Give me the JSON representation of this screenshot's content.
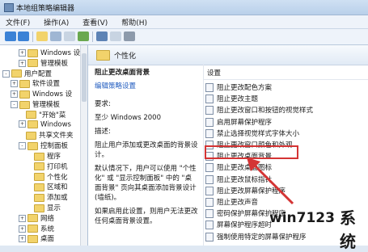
{
  "window": {
    "title": "本地组策略编辑器"
  },
  "menu": [
    "文件(F)",
    "操作(A)",
    "查看(V)",
    "帮助(H)"
  ],
  "tree": [
    {
      "label": "Windows 设",
      "depth": 2,
      "expander": "+"
    },
    {
      "label": "管理模板",
      "depth": 2,
      "expander": "+"
    },
    {
      "label": "用户配置",
      "depth": 0,
      "expander": "-"
    },
    {
      "label": "软件设置",
      "depth": 1,
      "expander": "+"
    },
    {
      "label": "Windows 设",
      "depth": 1,
      "expander": "+"
    },
    {
      "label": "管理模板",
      "depth": 1,
      "expander": "-"
    },
    {
      "label": "\"开始\"菜",
      "depth": 2,
      "expander": ""
    },
    {
      "label": "Windows",
      "depth": 2,
      "expander": "+"
    },
    {
      "label": "共享文件夹",
      "depth": 2,
      "expander": ""
    },
    {
      "label": "控制面板",
      "depth": 2,
      "expander": "-"
    },
    {
      "label": "程序",
      "depth": 3,
      "expander": ""
    },
    {
      "label": "打印机",
      "depth": 3,
      "expander": ""
    },
    {
      "label": "个性化",
      "depth": 3,
      "expander": ""
    },
    {
      "label": "区域和",
      "depth": 3,
      "expander": ""
    },
    {
      "label": "添加或",
      "depth": 3,
      "expander": ""
    },
    {
      "label": "显示",
      "depth": 3,
      "expander": ""
    },
    {
      "label": "网络",
      "depth": 2,
      "expander": "+"
    },
    {
      "label": "系统",
      "depth": 2,
      "expander": "+"
    },
    {
      "label": "桌面",
      "depth": 2,
      "expander": "+"
    }
  ],
  "main": {
    "header_title": "个性化",
    "policy_title": "阻止更改桌面背景",
    "edit_link": "编辑策略设置",
    "requirement_label": "要求:",
    "requirement_value": "至少 Windows 2000",
    "description_label": "描述:",
    "description_text": "阻止用户添加或更改桌面的背景设计。",
    "default_text": "默认情况下，用户可以使用 \"个性化\" 或 \"显示控制面板\" 中的 \"桌面背景\" 页向其桌面添加背景设计(墙纸)。",
    "enable_text": "如果启用此设置，则用户无法更改任何桌面背景设置。"
  },
  "settings": {
    "column_header": "设置",
    "items": [
      "阻止更改配色方案",
      "阻止更改主题",
      "阻止更改窗口和按钮的视觉样式",
      "启用屏幕保护程序",
      "禁止选择视觉样式字体大小",
      "阻止更改窗口颜色和外观",
      "阻止更改桌面背景",
      "阻止更改桌面图标",
      "阻止更改鼠标指针",
      "阻止更改屏幕保护程序",
      "阻止更改声音",
      "密码保护屏幕保护程序",
      "屏幕保护程序超时",
      "强制使用特定的屏幕保护程序"
    ],
    "highlighted_index": 6
  },
  "watermark": {
    "url": "win7123",
    "cn": "系统"
  },
  "colors": {
    "highlight": "#d43434",
    "link": "#1f5bbf"
  }
}
